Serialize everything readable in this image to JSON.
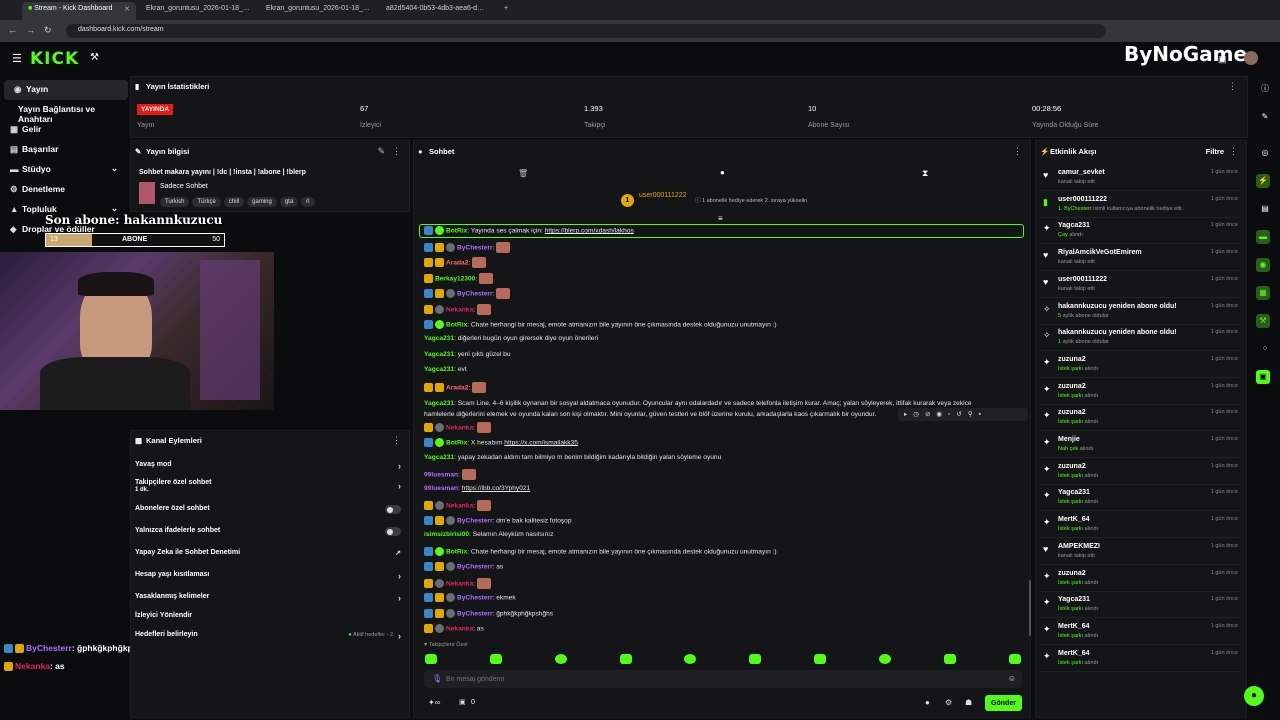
{
  "browser": {
    "tabs": [
      {
        "label": "Stream - Kick Dashboard"
      },
      {
        "label": "Ekran_goruntusu_2026-01-18_…"
      },
      {
        "label": "Ekran_goruntusu_2026-01-18_…"
      },
      {
        "label": "a82d5404-0b53-4db3-aea6-d…"
      }
    ],
    "url": "dashboard.kick.com/stream"
  },
  "header": {
    "logo": "KICK",
    "watermark": "ByNoGame"
  },
  "nav": {
    "items": [
      {
        "label": "Yayın",
        "icon": "broadcast-icon"
      },
      {
        "label": "Yayın Bağlantısı ve Anahtarı",
        "icon": ""
      },
      {
        "label": "Gelir",
        "icon": "revenue-icon"
      },
      {
        "label": "Başarılar",
        "icon": "achievements-icon"
      },
      {
        "label": "Stüdyo",
        "icon": "studio-icon"
      },
      {
        "label": "Denetleme",
        "icon": "moderation-icon"
      },
      {
        "label": "Topluluk",
        "icon": "community-icon"
      },
      {
        "label": "Droplar ve ödüller",
        "icon": "drops-icon"
      }
    ]
  },
  "overlay": {
    "sub_goal_title": "Son abone: hakannkuzucu",
    "bar_left": "13",
    "bar_label": "ABONE",
    "bar_right": "50",
    "bar_fill": 0.26,
    "chat1_user": "ByChesterr",
    "chat1_text": ": ğphkğkphğkpshğhs",
    "chat2_user": "Nekanka",
    "chat2_text": ": as"
  },
  "stats": {
    "title": "Yayın İstatistikleri",
    "live_badge": "YAYINDA",
    "items": [
      {
        "value": "",
        "label": "Yayın"
      },
      {
        "value": "67",
        "label": "İzleyici"
      },
      {
        "value": "1.393",
        "label": "Takipçi"
      },
      {
        "value": "10",
        "label": "Abone Sayısı"
      },
      {
        "value": "00:28:56",
        "label": "Yayında Olduğu Süre"
      }
    ]
  },
  "stream_info": {
    "title": "Yayın bilgisi",
    "stream_title": "Sohbet makara yayını | !dc | !insta | !abone | !blerp",
    "category": "Sadece Sohbet",
    "tags": [
      "Turkish",
      "Türkçe",
      "chill",
      "gaming",
      "gta",
      "rl"
    ]
  },
  "channel_actions": {
    "title": "Kanal Eylemleri",
    "rows": [
      {
        "label": "Yavaş mod",
        "sub": "",
        "ctrl": "chevron"
      },
      {
        "label": "Takipçilere özel sohbet",
        "sub": "1 dk.",
        "ctrl": "chevron"
      },
      {
        "label": "Abonelere özel sohbet",
        "sub": "",
        "ctrl": "toggle"
      },
      {
        "label": "Yalnızca ifadelerle sohbet",
        "sub": "",
        "ctrl": "toggle"
      },
      {
        "label": "Yapay Zeka ile Sohbet Denetimi",
        "sub": "",
        "ctrl": "external"
      },
      {
        "label": "Hesap yaşı kısıtlaması",
        "sub": "",
        "ctrl": "chevron"
      },
      {
        "label": "Yasaklanmış kelimeler",
        "sub": "",
        "ctrl": "chevron"
      },
      {
        "label": "İzleyici Yönlendir",
        "sub": "",
        "ctrl": ""
      },
      {
        "label": "Hedefleri belirleyin",
        "sub": "",
        "ctrl": "chevron"
      }
    ],
    "goals_status": "Aktif hedefler - 2"
  },
  "chat": {
    "title": "Sohbet",
    "pinned_user": "user000111222",
    "pinned_count": "1",
    "pinned_note": "1 abonelik hediye ederek 2. sıraya yükselin",
    "messages": [
      {
        "user": "BotRix",
        "color": "#53fc18",
        "badges": "bb,bg",
        "text": ": Yayında ses çalmak için: ",
        "link": "https://blerp.com/xdash/lakhos",
        "emote": false
      },
      {
        "user": "ByChesterr",
        "color": "#a970ff",
        "badges": "bb,by,bgr",
        "text": ": ",
        "link": "",
        "emote": true
      },
      {
        "user": "Arada2",
        "color": "#ff6b6b",
        "badges": "by,by",
        "text": ": ",
        "link": "",
        "emote": true
      },
      {
        "user": "Berkay12300",
        "color": "#53fc18",
        "badges": "by",
        "text": ": ",
        "link": "",
        "emote": true
      },
      {
        "user": "ByChesterr",
        "color": "#a970ff",
        "badges": "bb,by,bgr",
        "text": ": ",
        "link": "",
        "emote": true
      },
      {
        "user": "Nekanka",
        "color": "#e0245e",
        "badges": "by,bgr",
        "text": ": ",
        "link": "",
        "emote": true
      },
      {
        "user": "BotRix",
        "color": "#53fc18",
        "badges": "bb,bg",
        "text": ": Chate herhangi bir mesaj, emote atmanızın bile yayının öne çıkmasında destek olduğunuzu unutmayın :)",
        "link": "",
        "emote": false
      },
      {
        "user": "Yagca231",
        "color": "#53fc18",
        "badges": "",
        "text": ": diğerleri bugün oyun girersek diye oyun önerileri",
        "link": "",
        "emote": false
      },
      {
        "user": "Yagca231",
        "color": "#53fc18",
        "badges": "",
        "text": ": yeni çıktı güzel bu",
        "link": "",
        "emote": false
      },
      {
        "user": "Yagca231",
        "color": "#53fc18",
        "badges": "",
        "text": ": evt",
        "link": "",
        "emote": false
      },
      {
        "user": "Arada2",
        "color": "#ff6b6b",
        "badges": "by,by",
        "text": ": ",
        "link": "",
        "emote": true
      }
    ],
    "long_msg_user": "Yagca231",
    "long_msg_line1": ": Scam Line, 4–6 kişilik oynanan bir sosyal aldatmaca oyunudur. Oyuncular aynı odalardadır ve sadece telefonla iletişim kurar. Amaç; yalan söyleyerek, ittifak kurarak veya zekice",
    "long_msg_line2": "hamlelerle diğerlerini elemek ve oyunda kalan son kişi olmaktır. Mini oyunlar, güven testleri ve blöf üzerine kurulu, arkadaşlarla kaos çıkarmalık bir oyundur.",
    "messages2": [
      {
        "user": "Nekanka",
        "color": "#e0245e",
        "badges": "by,bgr",
        "text": ": ",
        "link": "",
        "emote": true
      },
      {
        "user": "BotRix",
        "color": "#53fc18",
        "badges": "bb,bg",
        "text": ": X hesabım ",
        "link": "https://x.com/ismailakk35",
        "emote": false
      },
      {
        "user": "Yagca231",
        "color": "#53fc18",
        "badges": "",
        "text": ": yapay zekadan aldım tam bilmiyo m benim bildiğim kadarıyla bildiğin yalan söyleme oyunu",
        "link": "",
        "emote": false
      },
      {
        "user": "99luesman",
        "color": "#a970ff",
        "badges": "",
        "text": ": ",
        "link": "",
        "emote": true
      },
      {
        "user": "99luesman",
        "color": "#a970ff",
        "badges": "",
        "text": ": ",
        "link": "https://ibb.co/3Yphy021",
        "emote": false
      },
      {
        "user": "Nekanka",
        "color": "#e0245e",
        "badges": "by,bgr",
        "text": ": ",
        "link": "",
        "emote": true
      },
      {
        "user": "ByChesterr",
        "color": "#a970ff",
        "badges": "bb,by,bgr",
        "text": ": dm'e bak kalitesiz fotoşop",
        "link": "",
        "emote": false
      },
      {
        "user": "isimsizbirisi00",
        "color": "#53fc18",
        "badges": "",
        "text": ": Selamın Aleyküm nasılsınız",
        "link": "",
        "emote": false
      },
      {
        "user": "BotRix",
        "color": "#53fc18",
        "badges": "bb,bg",
        "text": ": Chate herhangi bir mesaj, emote atmanızın bile yayının öne çıkmasında destek olduğunuzu unutmayın :)",
        "link": "",
        "emote": false
      },
      {
        "user": "ByChesterr",
        "color": "#a970ff",
        "badges": "bb,by,bgr",
        "text": ": as",
        "link": "",
        "emote": false
      },
      {
        "user": "Nekanka",
        "color": "#e0245e",
        "badges": "by,bgr",
        "text": ": ",
        "link": "",
        "emote": true
      },
      {
        "user": "ByChesterr",
        "color": "#a970ff",
        "badges": "bb,by,bgr",
        "text": ": ekmek",
        "link": "",
        "emote": false
      },
      {
        "user": "ByChesterr",
        "color": "#a970ff",
        "badges": "bb,by,bgr",
        "text": ": ğphkğkphğkpshğhs",
        "link": "",
        "emote": false
      },
      {
        "user": "Nekanka",
        "color": "#e0245e",
        "badges": "by,bgr",
        "text": ": as",
        "link": "",
        "emote": false
      }
    ],
    "follower_only": "Takipçilere Özel",
    "input_placeholder": "Bir mesaj gönderin",
    "send_label": "Gönder",
    "points": "0"
  },
  "activity": {
    "title": "Etkinlik Akışı",
    "filter": "Filtre",
    "events": [
      {
        "icon": "♥",
        "user": "camur_sevket",
        "sub": "kanalı takip etti",
        "hl": "",
        "time": "1 gün önce"
      },
      {
        "icon": "▮",
        "user": "user000111222",
        "sub": "isimli kullanıcıya abonelik hediye etti.",
        "hl": "1. ByChesterr",
        "time": "1 gün önce"
      },
      {
        "icon": "✦",
        "user": "Yagca231",
        "sub": "alındı",
        "hl": "Çay",
        "time": "1 gün önce"
      },
      {
        "icon": "♥",
        "user": "RiyalAmcikVeGotEmirem",
        "sub": "kanalı takip etti",
        "hl": "",
        "time": "1 gün önce"
      },
      {
        "icon": "♥",
        "user": "user000111222",
        "sub": "kanalı takip etti",
        "hl": "",
        "time": "1 gün önce"
      },
      {
        "icon": "✧",
        "user": "hakannkuzucu yeniden abone oldu!",
        "sub": "aylık abone oldular",
        "hl": "5",
        "time": "1 gün önce"
      },
      {
        "icon": "✧",
        "user": "hakannkuzucu yeniden abone oldu!",
        "sub": "aylık abone oldular",
        "hl": "1",
        "time": "1 gün önce"
      },
      {
        "icon": "✦",
        "user": "zuzuna2",
        "sub": "alındı",
        "hl": "İstek şarkı",
        "time": "1 gün önce"
      },
      {
        "icon": "✦",
        "user": "zuzuna2",
        "sub": "alındı",
        "hl": "İstek şarkı",
        "time": "1 gün önce"
      },
      {
        "icon": "✦",
        "user": "zuzuna2",
        "sub": "alındı",
        "hl": "İstek şarkı",
        "time": "1 gün önce"
      },
      {
        "icon": "✦",
        "user": "Menjie",
        "sub": "alındı",
        "hl": "Nah çek",
        "time": "1 gün önce"
      },
      {
        "icon": "✦",
        "user": "zuzuna2",
        "sub": "alındı",
        "hl": "İstek şarkı",
        "time": "1 gün önce"
      },
      {
        "icon": "✦",
        "user": "Yagca231",
        "sub": "alındı",
        "hl": "İstek şarkı",
        "time": "1 gün önce"
      },
      {
        "icon": "✦",
        "user": "MertK_64",
        "sub": "alındı",
        "hl": "İstek şarkı",
        "time": "1 gün önce"
      },
      {
        "icon": "♥",
        "user": "AMPEKMEZI",
        "sub": "kanalı takip etti",
        "hl": "",
        "time": "1 gün önce"
      },
      {
        "icon": "✦",
        "user": "zuzuna2",
        "sub": "alındı",
        "hl": "İstek şarkı",
        "time": "1 gün önce"
      },
      {
        "icon": "✦",
        "user": "Yagca231",
        "sub": "alındı",
        "hl": "İstek şarkı",
        "time": "1 gün önce"
      },
      {
        "icon": "✦",
        "user": "MertK_64",
        "sub": "alındı",
        "hl": "İstek şarkı",
        "time": "1 gün önce"
      },
      {
        "icon": "✦",
        "user": "MertK_64",
        "sub": "alındı",
        "hl": "İstek şarkı",
        "time": "1 gün önce"
      }
    ]
  },
  "colors": {
    "accent": "#53fc18",
    "live": "#e91916"
  }
}
